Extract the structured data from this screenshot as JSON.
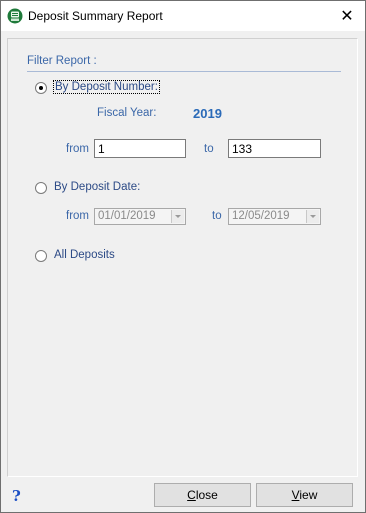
{
  "window": {
    "title": "Deposit Summary Report"
  },
  "filter": {
    "label": "Filter Report :",
    "options": [
      {
        "label": "By Deposit Number:",
        "selected": true
      },
      {
        "label": "By Deposit Date:",
        "selected": false
      },
      {
        "label": "All Deposits",
        "selected": false
      }
    ]
  },
  "deposit_number": {
    "fiscal_year_label": "Fiscal Year:",
    "fiscal_year_value": "2019",
    "from_label": "from",
    "from_value": "1",
    "to_label": "to",
    "to_value": "133"
  },
  "deposit_date": {
    "from_label": "from",
    "from_value": "01/01/2019",
    "to_label": "to",
    "to_value": "12/05/2019"
  },
  "buttons": {
    "close_label": "Close",
    "close_mnemonic": "C",
    "close_rest": "lose",
    "view_label": "View",
    "view_mnemonic": "V",
    "view_rest": "iew"
  },
  "help": {
    "icon": "?"
  },
  "colors": {
    "accent_text": "#3b67a8",
    "fiscal_year": "#2a6ab8",
    "help_icon": "#1b4fc4"
  },
  "icons": {
    "app": "app-icon",
    "close": "close-icon",
    "help": "help-icon"
  }
}
